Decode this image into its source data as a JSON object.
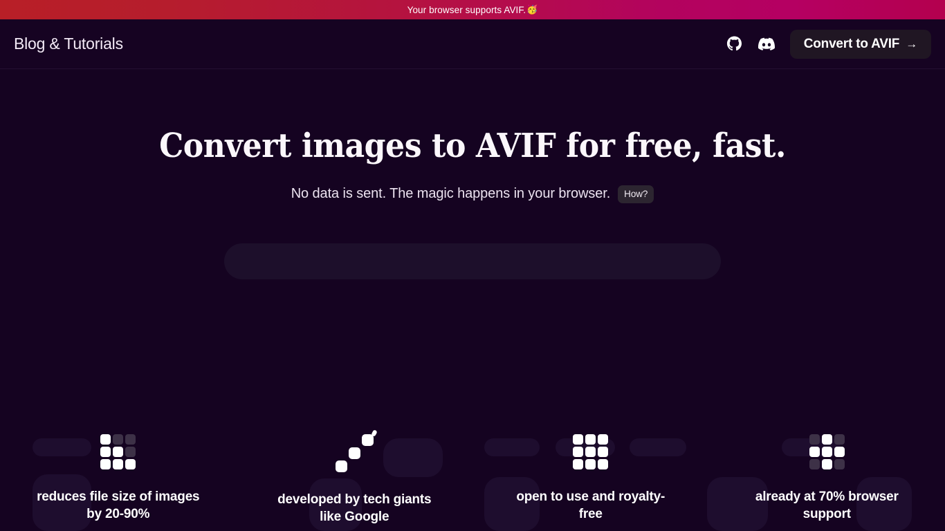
{
  "banner": {
    "text": "Your browser supports AVIF.",
    "emoji": "🥳",
    "gradient_start": "#b81f27",
    "gradient_mid": "#b3035e",
    "gradient_end": "#b4004e"
  },
  "navbar": {
    "brand": "Blog & Tutorials",
    "github_icon": "github-icon",
    "discord_icon": "discord-icon",
    "cta_label": "Convert to AVIF",
    "cta_arrow": "→",
    "cta_bg": "#201623"
  },
  "hero": {
    "headline": "Convert images to AVIF for free, fast.",
    "subline": "No data is sent. The magic happens in your browser.",
    "how_badge": "How?",
    "dropzone_placeholder": ""
  },
  "features": [
    {
      "icon": "grid-staircase-icon",
      "text": "reduces file size of images by 20-90%",
      "pattern": [
        1,
        0,
        0,
        1,
        1,
        0,
        1,
        1,
        1
      ]
    },
    {
      "icon": "grid-diagonal-growth-icon",
      "text": "developed by tech giants like Google",
      "pattern": [
        0,
        0,
        1,
        0,
        1,
        0,
        1,
        0,
        0
      ]
    },
    {
      "icon": "grid-full-icon",
      "text": "open to use and royalty-free",
      "pattern": [
        1,
        1,
        1,
        1,
        1,
        1,
        1,
        1,
        1
      ]
    },
    {
      "icon": "grid-cross-icon",
      "text": "already at 70% browser support",
      "pattern": [
        0,
        1,
        0,
        1,
        1,
        1,
        0,
        1,
        0
      ]
    }
  ],
  "theme": {
    "background": "#150321",
    "surface": "#1d0f2b",
    "text": "#ffffff"
  }
}
